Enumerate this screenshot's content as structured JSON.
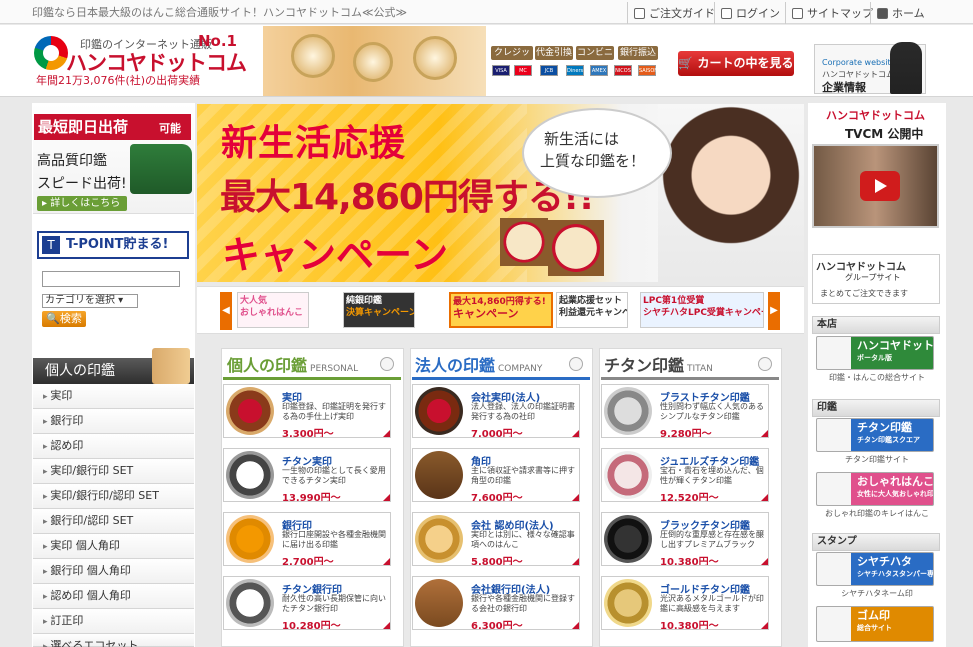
{
  "top": {
    "tagline": "印鑑なら日本最大級のはんこ総合通販サイト！ハンコヤドットコム≪公式≫",
    "nav": [
      "ご注文ガイド",
      "ログイン",
      "サイトマップ",
      "ホーム"
    ]
  },
  "header": {
    "logo_tag": "印鑑のインターネット通販",
    "logo_no1": "No.1",
    "logo_name": "ハンコヤドットコム",
    "logo_sub": "年間21万3,076件(社)の出荷実績",
    "payment_tags": [
      "クレジット",
      "代金引換",
      "コンビニ",
      "銀行振込"
    ],
    "cards": [
      "VISA",
      "MC",
      "JCB",
      "Diners",
      "AMEX",
      "NICOS",
      "SAISON"
    ],
    "cart_label": "カートの中を見る",
    "corp_small": "Corporate website",
    "corp_name": "ハンコヤドットコム",
    "corp_info": "企業情報"
  },
  "left": {
    "banner_title": "最短即日出荷",
    "banner_note": "可能",
    "banner_line1": "高品質印鑑",
    "banner_line2": "スピード出荷!",
    "banner_detail": "詳しくはこちら",
    "tpoint": "T-POINT貯まる!",
    "tpoint_logo": "T",
    "search_placeholder": "",
    "category_select": "カテゴリを選択",
    "search_button": "検索",
    "category_head": "個人の印鑑",
    "categories": [
      "実印",
      "銀行印",
      "認め印",
      "実印/銀行印 SET",
      "実印/銀行印/認印 SET",
      "銀行印/認印 SET",
      "実印 個人角印",
      "銀行印 個人角印",
      "認め印 個人角印",
      "訂正印",
      "選べるエコセット"
    ]
  },
  "hero": {
    "title": "新生活応援",
    "max": "最大14,860円得する!!",
    "campaign": "キャンペーン",
    "bubble1": "新生活には",
    "bubble2": "上質な印鑑を！"
  },
  "thumbs": [
    {
      "label": "大人気",
      "sub": "おしゃれはんこ"
    },
    {
      "label": "純銀印鑑",
      "sub": "決算キャンペーン"
    },
    {
      "label": "最大14,860円得する!",
      "sub": "キャンペーン"
    },
    {
      "label": "起業応援セット",
      "sub": "利益還元キャンペーン"
    },
    {
      "label": "LPC第1位受賞",
      "sub": "シヤチハタLPC受賞キャンペーン"
    }
  ],
  "columns": [
    {
      "title": "個人の印鑑",
      "eng": "PERSONAL",
      "color": "#6a9e36",
      "products": [
        {
          "name": "実印",
          "desc": "印鑑登録、印鑑証明を発行する為の手仕上げ実印",
          "price": "3,300円〜"
        },
        {
          "name": "チタン実印",
          "desc": "一生物の印鑑として長く愛用できるチタン実印",
          "price": "13,990円〜"
        },
        {
          "name": "銀行印",
          "desc": "銀行口座開設や各種金融機関に届け出る印鑑",
          "price": "2,700円〜"
        },
        {
          "name": "チタン銀行印",
          "desc": "耐久性の高い長期保管に向いたチタン銀行印",
          "price": "10,280円〜"
        }
      ]
    },
    {
      "title": "法人の印鑑",
      "eng": "COMPANY",
      "color": "#2a6cc4",
      "products": [
        {
          "name": "会社実印(法人)",
          "desc": "法人登録、法人の印鑑証明書発行する為の社印",
          "price": "7,000円〜"
        },
        {
          "name": "角印",
          "desc": "主に領収証や請求書等に押す角型の印鑑",
          "price": "7,600円〜"
        },
        {
          "name": "会社 認め印(法人)",
          "desc": "実印とは別に、様々な確認事項へのはんこ",
          "price": "5,800円〜"
        },
        {
          "name": "会社銀行印(法人)",
          "desc": "銀行や各種金融機関に登録する会社の銀行印",
          "price": "6,300円〜"
        }
      ]
    },
    {
      "title": "チタン印鑑",
      "eng": "TITAN",
      "color": "#777777",
      "products": [
        {
          "name": "ブラストチタン印鑑",
          "desc": "性別問わず幅広く人気のあるシンプルなチタン印鑑",
          "price": "9,280円〜"
        },
        {
          "name": "ジュエルズチタン印鑑",
          "desc": "宝石・貴石を埋め込んだ、個性が輝くチタン印鑑",
          "price": "12,520円〜"
        },
        {
          "name": "ブラックチタン印鑑",
          "desc": "圧倒的な重厚感と存在感を醸し出すプレミアムブラック",
          "price": "10,380円〜"
        },
        {
          "name": "ゴールドチタン印鑑",
          "desc": "光沢あるメタルゴールドが印鑑に高級感を与えます",
          "price": "10,380円〜"
        }
      ]
    }
  ],
  "right": {
    "tv_logo": "ハンコヤドットコム",
    "tv_title": "TVCM 公開中",
    "group_logo": "ハンコヤドットコム",
    "group_title": "グループサイト",
    "group_note": "まとめてご注文できます",
    "sections": [
      {
        "head": "本店",
        "banner": "ハンコヤドットコム",
        "banner_sub": "ポータル版",
        "caption": "印鑑・はんこの総合サイト",
        "color": "#2f8a3a"
      },
      {
        "head": "印鑑",
        "banner": "チタン印鑑",
        "banner_sub": "チタン印鑑スクエア",
        "caption": "チタン印鑑サイト",
        "color": "#2a6cc4"
      },
      {
        "head": "",
        "banner": "おしゃれはんこ",
        "banner_sub": "女性に大人気おしゃれ印鑑",
        "caption": "おしゃれ印鑑のキレイはんこ",
        "color": "#e0508c"
      },
      {
        "head": "スタンプ",
        "banner": "シヤチハタ",
        "banner_sub": "シヤチハタスタンパー専門店",
        "caption": "シヤチハタネーム印",
        "color": "#2a6cc4"
      },
      {
        "head": "",
        "banner": "ゴム印",
        "banner_sub": "総合サイト",
        "caption": "",
        "color": "#e08a00"
      }
    ]
  }
}
